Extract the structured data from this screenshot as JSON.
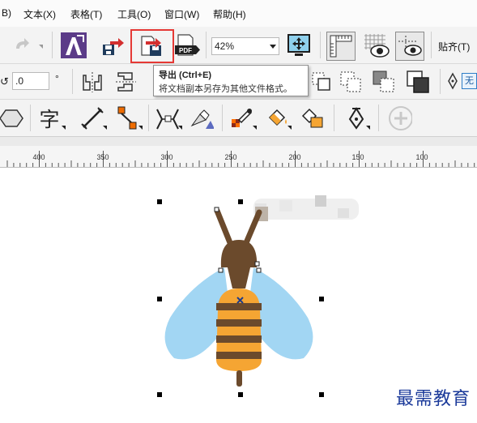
{
  "menu": {
    "items": [
      {
        "label": "B)"
      },
      {
        "label": "文本(X)"
      },
      {
        "label": "表格(T)"
      },
      {
        "label": "工具(O)"
      },
      {
        "label": "窗口(W)"
      },
      {
        "label": "帮助(H)"
      }
    ]
  },
  "toolbar": {
    "zoom_value": "42%",
    "snap_label": "贴齐(T)",
    "pdf_label": "PDF"
  },
  "property_bar": {
    "angle_value": ".0",
    "degree_symbol": "°",
    "none_label": "无"
  },
  "text_tool_glyph": "字",
  "tooltip": {
    "title": "导出 (Ctrl+E)",
    "description": "将文档副本另存为其他文件格式。"
  },
  "ruler": {
    "labels": [
      "400",
      "350",
      "300",
      "250",
      "200",
      "150",
      "100"
    ]
  },
  "watermark": "最需教育",
  "colors": {
    "highlight_border": "#e53935",
    "wing_blue": "#a2d6f3",
    "bee_brown": "#6b4a2c",
    "bee_orange": "#f5a533"
  }
}
